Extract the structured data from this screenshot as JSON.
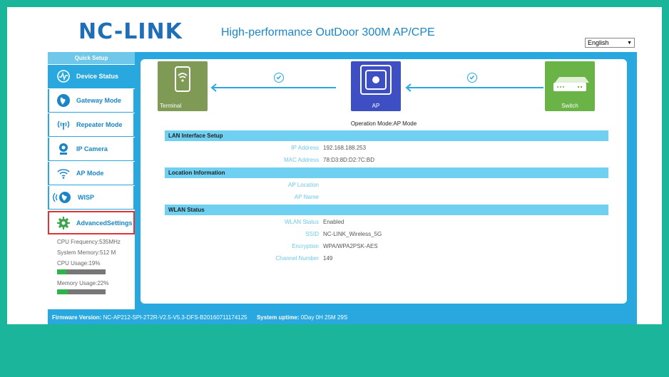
{
  "header": {
    "logo": "NC-LINK",
    "tagline": "High-performance OutDoor 300M AP/CPE",
    "language": "English"
  },
  "sidebar": {
    "quick_setup": "Quick Setup",
    "items": [
      {
        "label": "Device Status",
        "icon": "speedometer-icon",
        "active": true
      },
      {
        "label": "Gateway Mode",
        "icon": "globe-icon",
        "active": false
      },
      {
        "label": "Repeater Mode",
        "icon": "antenna-icon",
        "active": false
      },
      {
        "label": "IP Camera",
        "icon": "camera-icon",
        "active": false
      },
      {
        "label": "AP Mode",
        "icon": "wifi-icon",
        "active": false
      },
      {
        "label": "WISP",
        "icon": "globe-signal-icon",
        "active": false
      },
      {
        "label": "AdvancedSettings",
        "icon": "gear-icon",
        "active": false
      }
    ],
    "stats": {
      "cpu_frequency": "CPU Frequency:535MHz",
      "system_memory": "System Memory:512 M",
      "cpu_usage": "CPU Usage:19%",
      "cpu_usage_value": 0.19,
      "memory_usage": "Memory Usage:22%",
      "memory_usage_value": 0.22
    }
  },
  "topology": {
    "terminal": "Terminal",
    "ap": "AP",
    "switch": "Switch",
    "operation_mode": "Operation Mode:AP Mode"
  },
  "lan": {
    "title": "LAN Interface Setup",
    "ip_label": "IP Address",
    "ip_value": "192.168.188.253",
    "mac_label": "MAC Address",
    "mac_value": "78:D3:8D:D2:7C:BD"
  },
  "location": {
    "title": "Location Information",
    "ap_location_label": "AP Location",
    "ap_location_value": "",
    "ap_name_label": "AP Name",
    "ap_name_value": ""
  },
  "wlan": {
    "title": "WLAN Status",
    "status_label": "WLAN Status",
    "status_value": "Enabled",
    "ssid_label": "SSID",
    "ssid_value": "NC-LINK_Wireless_5G",
    "enc_label": "Encryption",
    "enc_value": "WPA/WPA2PSK-AES",
    "channel_label": "Channel Number",
    "channel_value": "149"
  },
  "footer": {
    "firmware_label": "Firmware Version:",
    "firmware_value": "NC-AP212-SPI-2T2R-V2.5-V5.3-DFS-B20160711174125",
    "uptime_label": "System uptime:",
    "uptime_value": "0Day 0H 25M 29S"
  },
  "colors": {
    "brand": "#1e6fb7",
    "accent": "#29a8e0",
    "background": "#1ab59b"
  }
}
